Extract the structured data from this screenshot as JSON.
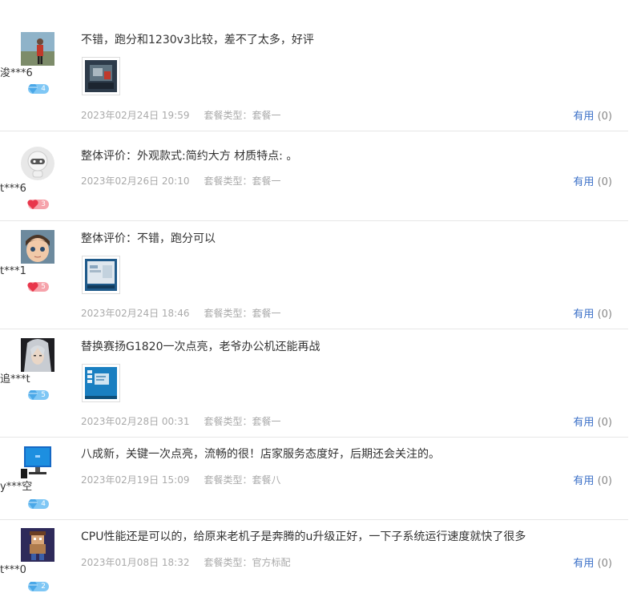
{
  "reviews": [
    {
      "user": "浚***6",
      "level": "4",
      "badge_color": "#7fc7f5",
      "badge_icon": "diamond-icon",
      "content": "不错，跑分和1230v3比较，差不了太多，好评",
      "date": "2023年02月24日 19:59",
      "package": "套餐类型：套餐一",
      "useful_label": "有用",
      "useful_count": "(0)"
    },
    {
      "user": "t***6",
      "level": "3",
      "badge_color": "#f6a3ab",
      "badge_icon": "heart-icon",
      "content": "整体评价：外观款式:简约大方 材质特点: 。",
      "date": "2023年02月26日 20:10",
      "package": "套餐类型：套餐一",
      "useful_label": "有用",
      "useful_count": "(0)"
    },
    {
      "user": "t***1",
      "level": "5",
      "badge_color": "#f6a3ab",
      "badge_icon": "heart-icon",
      "content": "整体评价：不错，跑分可以",
      "date": "2023年02月24日 18:46",
      "package": "套餐类型：套餐一",
      "useful_label": "有用",
      "useful_count": "(0)"
    },
    {
      "user": "追***t",
      "level": "5",
      "badge_color": "#7fc7f5",
      "badge_icon": "diamond-icon",
      "content": "替换赛扬G1820一次点亮，老爷办公机还能再战",
      "date": "2023年02月28日 00:31",
      "package": "套餐类型：套餐一",
      "useful_label": "有用",
      "useful_count": "(0)"
    },
    {
      "user": "y***空",
      "level": "4",
      "badge_color": "#7fc7f5",
      "badge_icon": "diamond-icon",
      "content": "八成新，关键一次点亮，流畅的很！店家服务态度好，后期还会关注的。",
      "date": "2023年02月19日 15:09",
      "package": "套餐类型：套餐八",
      "useful_label": "有用",
      "useful_count": "(0)"
    },
    {
      "user": "t***0",
      "level": "2",
      "badge_color": "#7fc7f5",
      "badge_icon": "diamond-icon",
      "content": "CPU性能还是可以的，给原来老机子是奔腾的u升级正好，一下子系统运行速度就快了很多",
      "date": "2023年01月08日 18:32",
      "package": "套餐类型：官方标配",
      "useful_label": "有用",
      "useful_count": "(0)"
    }
  ]
}
